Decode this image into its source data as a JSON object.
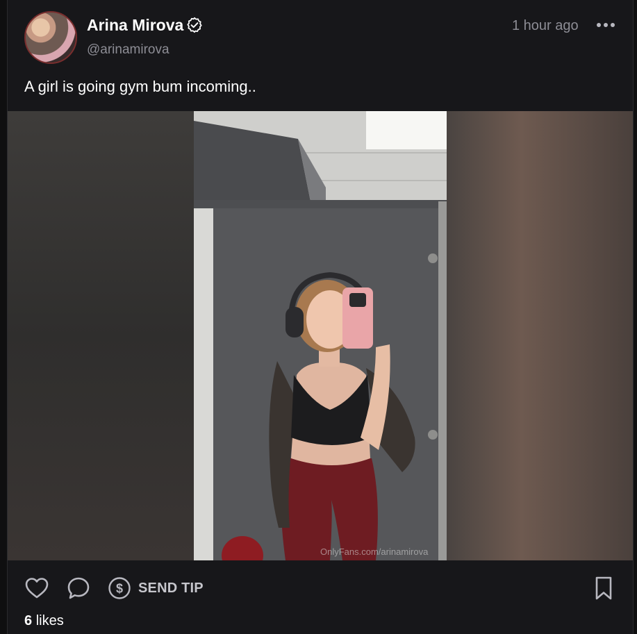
{
  "post": {
    "author": {
      "name": "Arina Mirova",
      "handle": "@arinamirova",
      "verified": true
    },
    "timestamp": "1 hour ago",
    "caption": "A girl is going gym bum incoming..",
    "media": {
      "watermark": "OnlyFans.com/arinamirova"
    },
    "actions": {
      "like_icon": "heart-icon",
      "comment_icon": "speech-bubble-icon",
      "tip_icon": "dollar-circle-icon",
      "send_tip_label": "SEND TIP",
      "bookmark_icon": "bookmark-icon",
      "more_icon": "more-horizontal-icon"
    },
    "likes": {
      "count": "6",
      "label": "likes"
    }
  },
  "colors": {
    "background": "#17171a",
    "text_primary": "#ffffff",
    "text_muted": "#8d8d95"
  }
}
